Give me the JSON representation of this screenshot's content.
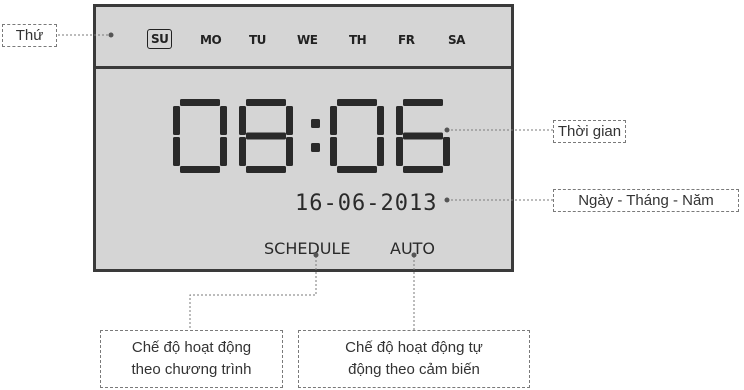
{
  "display": {
    "days": [
      {
        "label": "SU",
        "selected": true
      },
      {
        "label": "MO",
        "selected": false
      },
      {
        "label": "TU",
        "selected": false
      },
      {
        "label": "WE",
        "selected": false
      },
      {
        "label": "TH",
        "selected": false
      },
      {
        "label": "FR",
        "selected": false
      },
      {
        "label": "SA",
        "selected": false
      }
    ],
    "time": "08:06",
    "date": "16-06-2013",
    "mode_schedule": "SCHEDULE",
    "mode_auto": "AUTO"
  },
  "labels": {
    "weekday": "Thứ",
    "time": "Thời gian",
    "date": "Ngày - Tháng - Năm",
    "schedule_line1": "Chế độ hoạt động",
    "schedule_line2": "theo chương trình",
    "auto_line1": "Chế độ hoạt động tự",
    "auto_line2": "động theo cảm biến"
  },
  "colors": {
    "lcd_background": "#d5d5d5",
    "segment": "#2a2a2a",
    "frame": "#3a3a3a",
    "leader": "#7a7a7a"
  }
}
